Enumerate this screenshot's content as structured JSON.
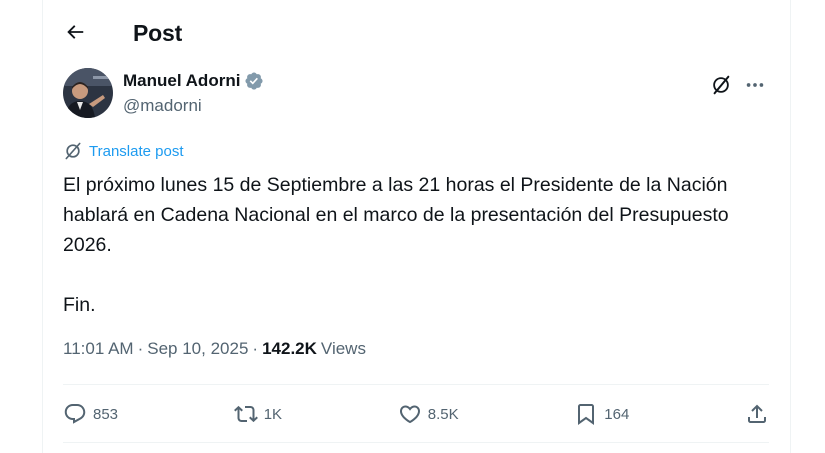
{
  "header": {
    "title": "Post"
  },
  "author": {
    "name": "Manuel Adorni",
    "handle": "@madorni"
  },
  "translate_label": "Translate post",
  "post": {
    "paragraphs": [
      "El próximo lunes 15 de Septiembre a las 21 horas el Presidente de la Nación hablará en Cadena Nacional en el marco de la presentación del Presupuesto 2026.",
      "Fin."
    ]
  },
  "meta": {
    "time": "11:01 AM",
    "separator": "·",
    "date": "Sep 10, 2025",
    "views_count": "142.2K",
    "views_label": "Views"
  },
  "actions": {
    "replies": "853",
    "reposts": "1K",
    "likes": "8.5K",
    "bookmarks": "164"
  },
  "colors": {
    "accent": "#1d9bf0",
    "text": "#0f1419",
    "secondary": "#536471",
    "border": "#eff3f4"
  },
  "icons": {
    "back": "arrow-left-icon",
    "verified": "verified-badge-icon",
    "grok": "grok-icon",
    "more": "more-horizontal-icon",
    "translate": "translate-icon",
    "reply": "reply-icon",
    "repost": "repost-icon",
    "like": "heart-icon",
    "bookmark": "bookmark-icon",
    "share": "share-icon"
  }
}
